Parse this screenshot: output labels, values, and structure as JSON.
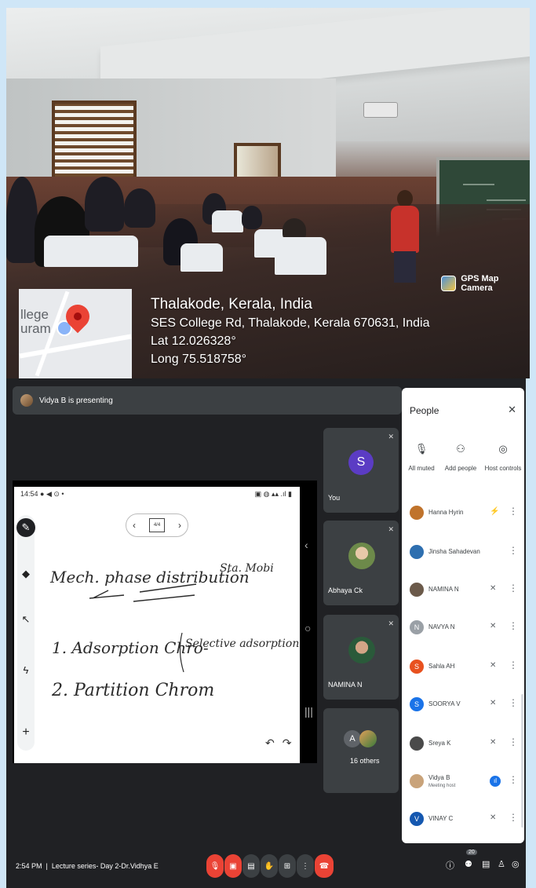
{
  "photo": {
    "location_title": "Thalakode, Kerala, India",
    "address": "SES College Rd, Thalakode, Kerala 670631, India",
    "latitude": "Lat 12.026328°",
    "longitude": "Long 75.518758°",
    "map_label": "llege\nuram",
    "gps_badge": "GPS Map Camera"
  },
  "meet": {
    "presenting_text": "Vidya B is presenting",
    "slide": {
      "status_time": "14:54",
      "page_indicator": "4/4",
      "ink_lines": [
        "Mech. phase distribution",
        "Sta. Mobi",
        "1. Adsorption Chro-",
        "Selective adsorption",
        "2. Partition Chrom"
      ]
    },
    "tiles": [
      {
        "label": "You",
        "avatar": "S",
        "color": "#5b3cc4"
      },
      {
        "label": "Abhaya Ck",
        "avatar": "",
        "color": "#6d8a4a"
      },
      {
        "label": "NAMINA N",
        "avatar": "",
        "color": "#8a6a58"
      },
      {
        "label": "16 others",
        "avatar": "A",
        "color": "#5f6368"
      }
    ],
    "people_panel": {
      "title": "People",
      "actions": [
        "All muted",
        "Add people",
        "Host controls"
      ],
      "participants": [
        {
          "name": "Hanna Hyrin",
          "sub": "",
          "initial": "",
          "color": "#c0732c"
        },
        {
          "name": "Jinsha Sahadevan",
          "sub": "",
          "initial": "",
          "color": "#2e6fb0"
        },
        {
          "name": "NAMINA N",
          "sub": "",
          "initial": "",
          "color": "#6b5a4a"
        },
        {
          "name": "NAVYA N",
          "sub": "",
          "initial": "N",
          "color": "#9aa0a6"
        },
        {
          "name": "Sahla AH",
          "sub": "",
          "initial": "S",
          "color": "#e8511f"
        },
        {
          "name": "SOORYA V",
          "sub": "",
          "initial": "S",
          "color": "#1a73e8"
        },
        {
          "name": "Sreya K",
          "sub": "",
          "initial": "",
          "color": "#4a4a4a"
        },
        {
          "name": "Vidya B",
          "sub": "Meeting host",
          "initial": "",
          "color": "#c9a37a"
        },
        {
          "name": "VINAY C",
          "sub": "",
          "initial": "V",
          "color": "#1558b0"
        }
      ]
    },
    "bottom_bar": {
      "time": "2:54 PM",
      "meeting_title": "Lecture series- Day 2-Dr.Vidhya E",
      "people_count": "20"
    }
  },
  "icons": [
    "map-pin-icon",
    "mic-off-icon",
    "camera-off-icon",
    "captions-icon",
    "raise-hand-icon",
    "present-icon",
    "more-icon",
    "end-call-icon",
    "info-icon",
    "people-icon",
    "chat-icon",
    "activities-icon",
    "host-controls-icon",
    "add-person-icon",
    "close-icon",
    "pen-icon",
    "eraser-icon",
    "pointer-icon",
    "laser-icon",
    "plus-icon",
    "undo-icon",
    "redo-icon"
  ]
}
